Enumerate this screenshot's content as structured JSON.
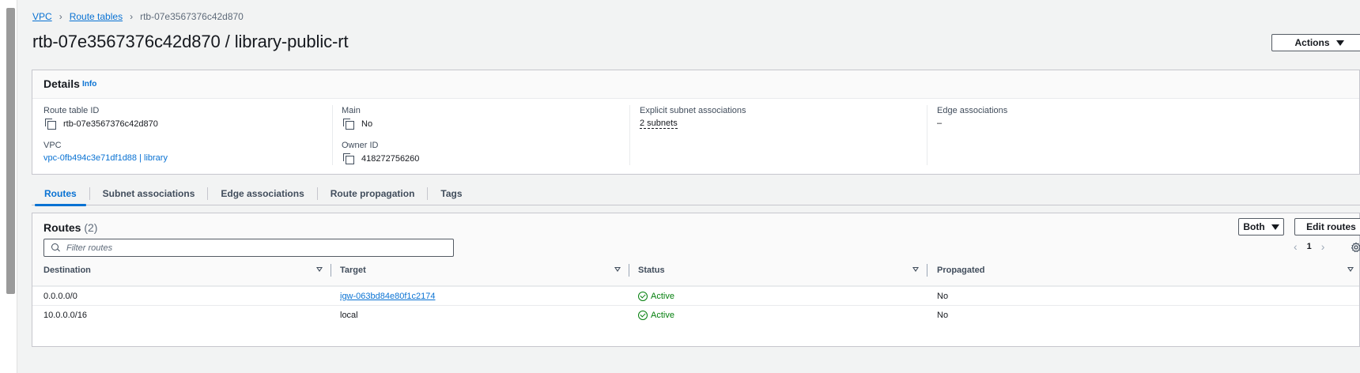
{
  "breadcrumb": {
    "items": [
      {
        "label": "VPC"
      },
      {
        "label": "Route tables"
      }
    ],
    "current": "rtb-07e3567376c42d870"
  },
  "page": {
    "title": "rtb-07e3567376c42d870 / library-public-rt",
    "actions_label": "Actions"
  },
  "details": {
    "title": "Details",
    "info_label": "Info",
    "route_table_id_label": "Route table ID",
    "route_table_id": "rtb-07e3567376c42d870",
    "vpc_label": "VPC",
    "vpc_value": "vpc-0fb494c3e71df1d88 | library",
    "main_label": "Main",
    "main_value": "No",
    "owner_label": "Owner ID",
    "owner_value": "418272756260",
    "explicit_label": "Explicit subnet associations",
    "explicit_value": "2 subnets",
    "edge_label": "Edge associations",
    "edge_value": "–"
  },
  "tabs": [
    {
      "label": "Routes",
      "active": true
    },
    {
      "label": "Subnet associations"
    },
    {
      "label": "Edge associations"
    },
    {
      "label": "Route propagation"
    },
    {
      "label": "Tags"
    }
  ],
  "routes": {
    "title": "Routes",
    "count": "(2)",
    "filter_label": "Both",
    "edit_label": "Edit routes",
    "search_placeholder": "Filter routes",
    "page_number": "1",
    "columns": [
      "Destination",
      "Target",
      "Status",
      "Propagated"
    ],
    "rows": [
      {
        "destination": "0.0.0.0/0",
        "target": "igw-063bd84e80f1c2174",
        "status": "Active",
        "propagated": "No"
      },
      {
        "destination": "10.0.0.0/16",
        "target": "local",
        "status": "Active",
        "propagated": "No"
      }
    ]
  },
  "colors": {
    "link": "#0972d3",
    "success": "#037f0c",
    "border": "#c6c6cd",
    "background": "#f2f3f3"
  },
  "icons": [
    "chevron-right-icon",
    "copy-icon",
    "search-icon",
    "gear-icon",
    "caret-down-icon",
    "check-circle-icon",
    "sort-icon"
  ]
}
